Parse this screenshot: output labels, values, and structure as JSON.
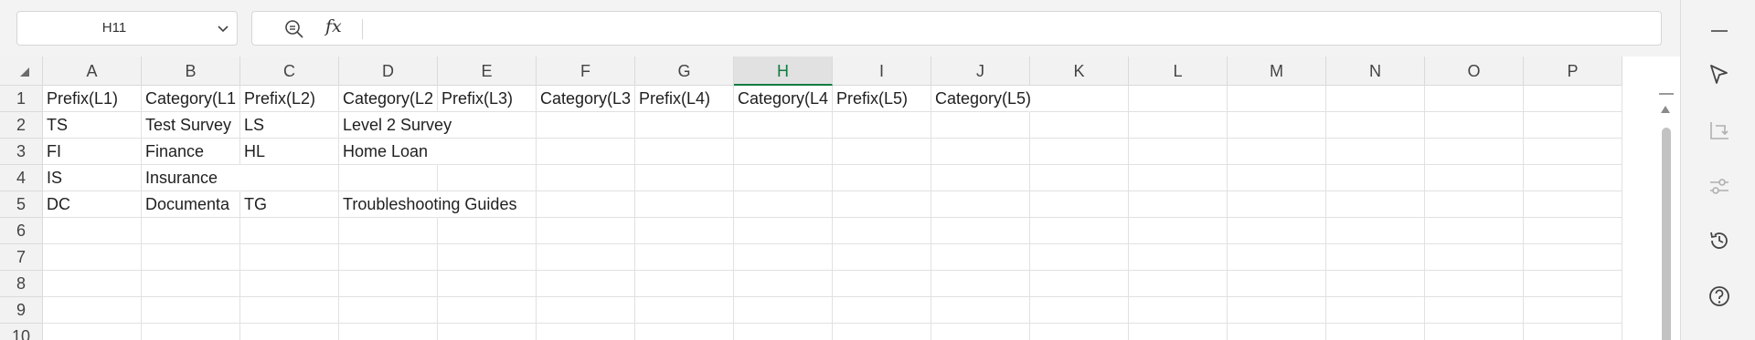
{
  "namebox": {
    "value": "H11"
  },
  "formula_bar": {
    "fx_label": "fx",
    "value": ""
  },
  "columns": [
    "A",
    "B",
    "C",
    "D",
    "E",
    "F",
    "G",
    "H",
    "I",
    "J",
    "K",
    "L",
    "M",
    "N",
    "O",
    "P"
  ],
  "active_column": "H",
  "rows": [
    "1",
    "2",
    "3",
    "4",
    "5",
    "6",
    "7",
    "8",
    "9",
    "10"
  ],
  "cells": [
    {
      "ref": "A1",
      "value": "Prefix(L1)"
    },
    {
      "ref": "B1",
      "value": "Category(L1"
    },
    {
      "ref": "C1",
      "value": "Prefix(L2)"
    },
    {
      "ref": "D1",
      "value": "Category(L2"
    },
    {
      "ref": "E1",
      "value": "Prefix(L3)"
    },
    {
      "ref": "F1",
      "value": "Category(L3"
    },
    {
      "ref": "G1",
      "value": "Prefix(L4)"
    },
    {
      "ref": "H1",
      "value": "Category(L4"
    },
    {
      "ref": "I1",
      "value": "Prefix(L5)"
    },
    {
      "ref": "J1",
      "value": "Category(L5)"
    },
    {
      "ref": "A2",
      "value": "TS"
    },
    {
      "ref": "B2",
      "value": "Test Survey"
    },
    {
      "ref": "C2",
      "value": "LS"
    },
    {
      "ref": "D2",
      "value": "Level 2 Survey"
    },
    {
      "ref": "A3",
      "value": "FI"
    },
    {
      "ref": "B3",
      "value": "Finance"
    },
    {
      "ref": "C3",
      "value": "HL"
    },
    {
      "ref": "D3",
      "value": "Home Loan"
    },
    {
      "ref": "A4",
      "value": "IS"
    },
    {
      "ref": "B4",
      "value": "Insurance"
    },
    {
      "ref": "A5",
      "value": "DC"
    },
    {
      "ref": "B5",
      "value": "Documenta"
    },
    {
      "ref": "C5",
      "value": "TG"
    },
    {
      "ref": "D5",
      "value": "Troubleshooting Guides"
    }
  ],
  "side_panel_icons": [
    "minimize-icon",
    "select-pointer-icon",
    "chart-axis-icon",
    "sliders-icon",
    "history-icon",
    "help-icon"
  ]
}
